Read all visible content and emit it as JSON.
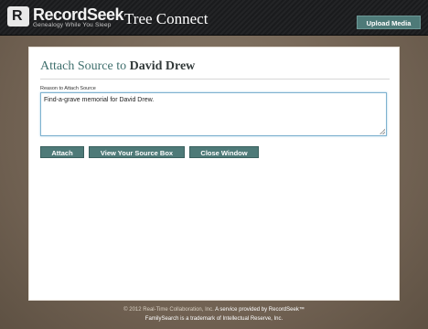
{
  "header": {
    "logo_initial": "R",
    "logo_text": "RecordSeek",
    "logo_tagline": "Genealogy While You Sleep",
    "app_title": "Tree Connect",
    "upload_label": "Upload Media"
  },
  "panel": {
    "heading_prefix": "Attach Source to",
    "heading_name": "David Drew",
    "field_label": "Reason to Attach Source",
    "reason_value": "Find-a-grave memorial for David Drew.",
    "buttons": {
      "attach": "Attach",
      "view_source_box": "View Your Source Box",
      "close_window": "Close Window"
    }
  },
  "footer": {
    "copyright": "© 2012 Real-Time Collaboration, Inc.",
    "service_prefix": "A service provided by",
    "service_name": "RecordSeek™",
    "trademark": "FamilySearch is a trademark of Intellectual Reserve, Inc."
  },
  "colors": {
    "accent": "#4e7a78",
    "heading": "#3f6f6d",
    "topbar": "#1d1e20",
    "background": "#7a6b5c"
  }
}
